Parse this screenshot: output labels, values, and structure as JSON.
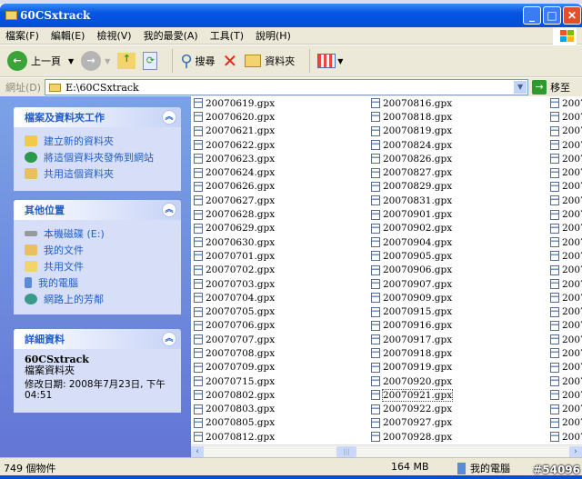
{
  "window": {
    "title": "60CSxtrack"
  },
  "menu": [
    "檔案(F)",
    "編輯(E)",
    "檢視(V)",
    "我的最愛(A)",
    "工具(T)",
    "說明(H)"
  ],
  "toolbar": {
    "back": "上一頁",
    "search": "搜尋",
    "folders": "資料夾"
  },
  "address": {
    "label": "網址(D)",
    "value": "E:\\60CSxtrack",
    "go": "移至"
  },
  "sidebar": {
    "tasks": {
      "title": "檔案及資料夾工作",
      "items": [
        "建立新的資料夾",
        "將這個資料夾發佈到網站",
        "共用這個資料夾"
      ]
    },
    "places": {
      "title": "其他位置",
      "items": [
        "本機磁碟 (E:)",
        "我的文件",
        "共用文件",
        "我的電腦",
        "網路上的芳鄰"
      ]
    },
    "details": {
      "title": "詳細資料",
      "name": "60CSxtrack",
      "type": "檔案資料夾",
      "modified": "修改日期: 2008年7月23日, 下午 04:51"
    }
  },
  "files": {
    "col1": [
      "20070619.gpx",
      "20070620.gpx",
      "20070621.gpx",
      "20070622.gpx",
      "20070623.gpx",
      "20070624.gpx",
      "20070626.gpx",
      "20070627.gpx",
      "20070628.gpx",
      "20070629.gpx",
      "20070630.gpx",
      "20070701.gpx",
      "20070702.gpx",
      "20070703.gpx",
      "20070704.gpx",
      "20070705.gpx",
      "20070706.gpx",
      "20070707.gpx",
      "20070708.gpx",
      "20070709.gpx",
      "20070715.gpx",
      "20070802.gpx",
      "20070803.gpx",
      "20070805.gpx",
      "20070812.gpx"
    ],
    "col2": [
      "20070816.gpx",
      "20070818.gpx",
      "20070819.gpx",
      "20070824.gpx",
      "20070826.gpx",
      "20070827.gpx",
      "20070829.gpx",
      "20070831.gpx",
      "20070901.gpx",
      "20070902.gpx",
      "20070904.gpx",
      "20070905.gpx",
      "20070906.gpx",
      "20070907.gpx",
      "20070909.gpx",
      "20070915.gpx",
      "20070916.gpx",
      "20070917.gpx",
      "20070918.gpx",
      "20070919.gpx",
      "20070920.gpx",
      "20070921.gpx",
      "20070922.gpx",
      "20070927.gpx",
      "20070928.gpx"
    ],
    "col3_prefix": "2007",
    "selected": "20070921.gpx"
  },
  "status": {
    "count": "749 個物件",
    "size": "164 MB",
    "location": "我的電腦"
  },
  "watermark": "#54096"
}
